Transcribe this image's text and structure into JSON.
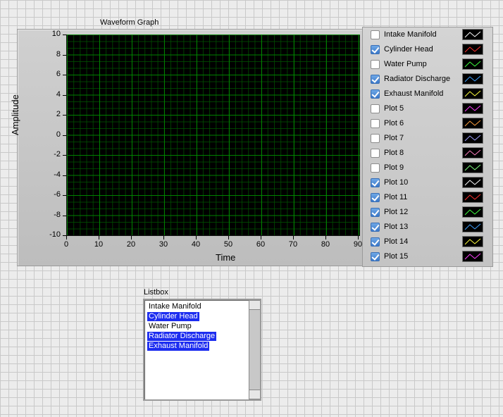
{
  "graph": {
    "title": "Waveform Graph",
    "xlabel": "Time",
    "ylabel": "Amplitude",
    "yticks": [
      "10",
      "8",
      "6",
      "4",
      "2",
      "0",
      "-2",
      "-4",
      "-6",
      "-8",
      "-10"
    ],
    "xticks": [
      "0",
      "10",
      "20",
      "30",
      "40",
      "50",
      "60",
      "70",
      "80",
      "90"
    ]
  },
  "legend": {
    "items": [
      {
        "name": "Intake Manifold",
        "checked": false,
        "color": "#ffffff"
      },
      {
        "name": "Cylinder Head",
        "checked": true,
        "color": "#ff3030"
      },
      {
        "name": "Water Pump",
        "checked": false,
        "color": "#40ff40"
      },
      {
        "name": "Radiator Discharge",
        "checked": true,
        "color": "#40a0ff"
      },
      {
        "name": "Exhaust Manifold",
        "checked": true,
        "color": "#ffff40"
      },
      {
        "name": "Plot 5",
        "checked": false,
        "color": "#ff40ff"
      },
      {
        "name": "Plot 6",
        "checked": false,
        "color": "#ffa040"
      },
      {
        "name": "Plot 7",
        "checked": false,
        "color": "#a0a0ff"
      },
      {
        "name": "Plot 8",
        "checked": false,
        "color": "#ff80c0"
      },
      {
        "name": "Plot 9",
        "checked": false,
        "color": "#80ff80"
      },
      {
        "name": "Plot 10",
        "checked": true,
        "color": "#ffffff"
      },
      {
        "name": "Plot 11",
        "checked": true,
        "color": "#ff3030"
      },
      {
        "name": "Plot 12",
        "checked": true,
        "color": "#40ff40"
      },
      {
        "name": "Plot 13",
        "checked": true,
        "color": "#40a0ff"
      },
      {
        "name": "Plot 14",
        "checked": true,
        "color": "#ffff40"
      },
      {
        "name": "Plot 15",
        "checked": true,
        "color": "#ff40ff"
      }
    ]
  },
  "listbox": {
    "label": "Listbox",
    "items": [
      {
        "text": "Intake Manifold",
        "selected": false
      },
      {
        "text": "Cylinder Head",
        "selected": true
      },
      {
        "text": "Water Pump",
        "selected": false
      },
      {
        "text": "Radiator Discharge",
        "selected": true
      },
      {
        "text": "Exhaust Manifold",
        "selected": true
      }
    ]
  }
}
